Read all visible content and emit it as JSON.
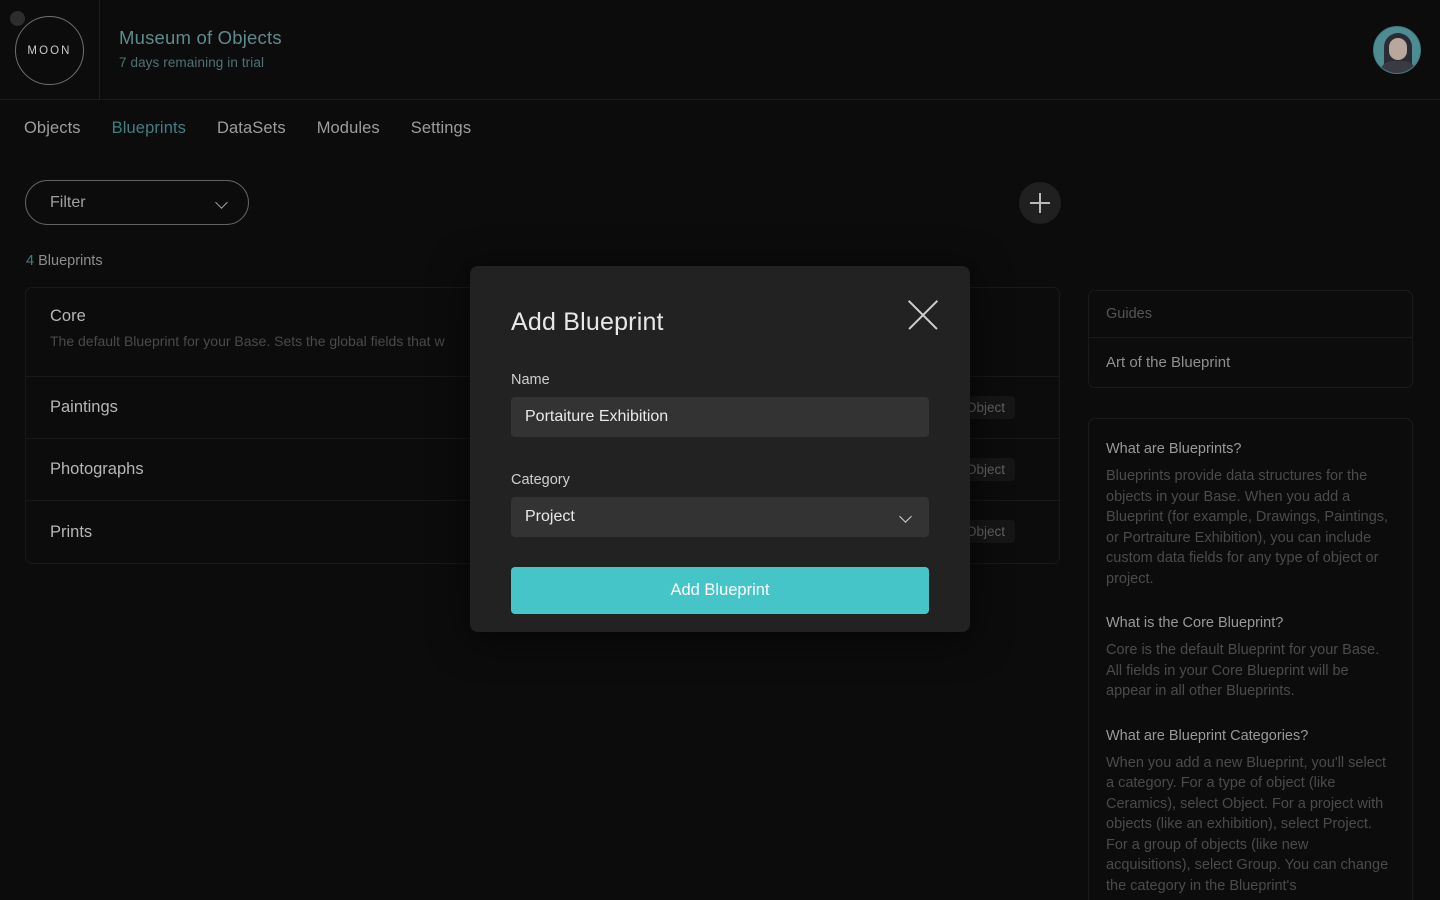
{
  "header": {
    "logo_text": "MOON",
    "title": "Museum of Objects",
    "subtitle": "7 days remaining in trial"
  },
  "nav": {
    "items": [
      {
        "label": "Objects",
        "active": false
      },
      {
        "label": "Blueprints",
        "active": true
      },
      {
        "label": "DataSets",
        "active": false
      },
      {
        "label": "Modules",
        "active": false
      },
      {
        "label": "Settings",
        "active": false
      }
    ]
  },
  "toolbar": {
    "filter_label": "Filter",
    "add_label": "+"
  },
  "list": {
    "count_number": "4",
    "count_label": " Blueprints",
    "rows": [
      {
        "name": "Core",
        "description": "The default Blueprint for your Base. Sets the global fields that w",
        "badge": ""
      },
      {
        "name": "Paintings",
        "description": "",
        "badge": "Object"
      },
      {
        "name": "Photographs",
        "description": "",
        "badge": "Object"
      },
      {
        "name": "Prints",
        "description": "",
        "badge": "Object"
      }
    ]
  },
  "guides": {
    "header": "Guides",
    "items": [
      {
        "label": "Art of the Blueprint"
      }
    ],
    "faqs": [
      {
        "question": "What are Blueprints?",
        "answer": "Blueprints provide data structures for the objects in your Base. When you add a Blueprint (for example, Drawings, Paintings, or Portraiture Exhibition), you can include custom data fields for any type of object or project."
      },
      {
        "question": "What is the Core Blueprint?",
        "answer": "Core is the default Blueprint for your Base. All fields in your Core Blueprint will be appear in all other Blueprints."
      },
      {
        "question": "What are Blueprint Categories?",
        "answer": "When you add a new Blueprint, you'll select a category. For a type of object (like Ceramics), select Object. For a project with objects (like an exhibition), select Project. For a group of objects (like new acquisitions), select Group. You can change the category in the Blueprint's"
      }
    ]
  },
  "modal": {
    "title": "Add Blueprint",
    "name_label": "Name",
    "name_value": "Portaiture Exhibition",
    "name_placeholder": "Name",
    "category_label": "Category",
    "category_value": "Project",
    "submit_label": "Add Blueprint",
    "close_icon": "close-icon"
  },
  "colors": {
    "accent": "#45c5c8",
    "brand_teal": "#3f7f82",
    "background": "#0c0c0c",
    "modal_bg": "#222222",
    "input_bg": "#333333"
  }
}
